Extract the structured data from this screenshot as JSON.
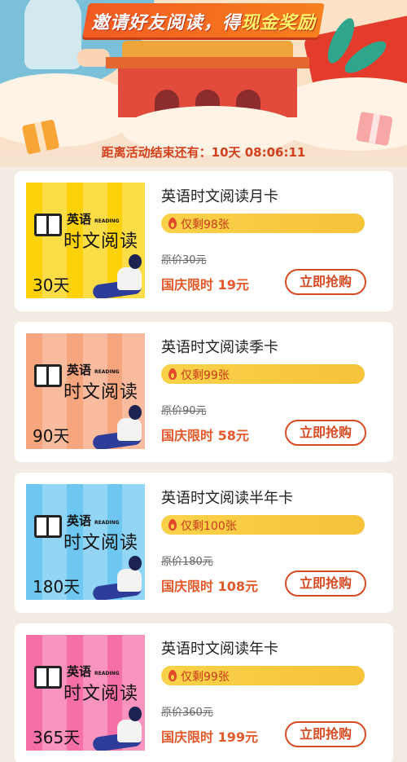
{
  "banner": {
    "title_pre": "邀请好友阅读，得",
    "title_highlight": "现金奖励",
    "countdown": "距离活动结束还有：10天  08:06:11"
  },
  "products": [
    {
      "name": "英语时文阅读月卡",
      "stock": "仅剩98张",
      "original_price": "原价30元",
      "sale_price": "国庆限时 19元",
      "buy_label": "立即抢购",
      "thumb": {
        "brand_small": "英语",
        "brand_reading": "READING",
        "brand_big": "时文阅读",
        "days": "30天",
        "bg": "#fdd20a"
      }
    },
    {
      "name": "英语时文阅读季卡",
      "stock": "仅剩99张",
      "original_price": "原价90元",
      "sale_price": "国庆限时 58元",
      "buy_label": "立即抢购",
      "thumb": {
        "brand_small": "英语",
        "brand_reading": "READING",
        "brand_big": "时文阅读",
        "days": "90天",
        "bg": "#f7a57c"
      }
    },
    {
      "name": "英语时文阅读半年卡",
      "stock": "仅剩100张",
      "original_price": "原价180元",
      "sale_price": "国庆限时 108元",
      "buy_label": "立即抢购",
      "thumb": {
        "brand_small": "英语",
        "brand_reading": "READING",
        "brand_big": "时文阅读",
        "days": "180天",
        "bg": "#6ec7f0"
      }
    },
    {
      "name": "英语时文阅读年卡",
      "stock": "仅剩99张",
      "original_price": "原价360元",
      "sale_price": "国庆限时 199元",
      "buy_label": "立即抢购",
      "thumb": {
        "brand_small": "英语",
        "brand_reading": "READING",
        "brand_big": "时文阅读",
        "days": "365天",
        "bg": "#f670a7"
      }
    }
  ],
  "colors": {
    "accent": "#d84a22",
    "stock_bar": "#f6c339",
    "page_bg": "#f2ece4"
  }
}
